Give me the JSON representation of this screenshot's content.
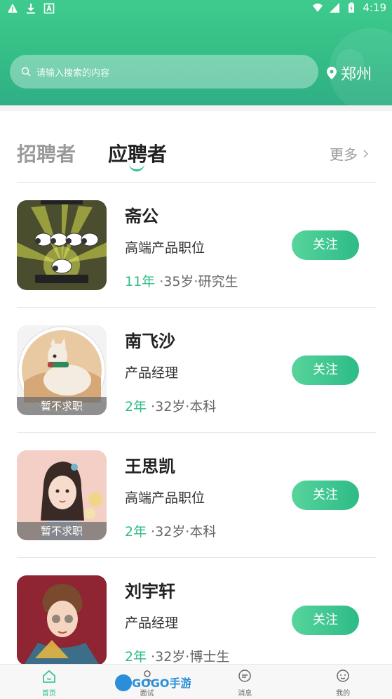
{
  "statusbar": {
    "time": "4:19"
  },
  "header": {
    "search_placeholder": "请输入搜索的内容",
    "location": "郑州"
  },
  "tabs": {
    "recruiter": "招聘者",
    "applicant": "应聘者",
    "more": "更多"
  },
  "candidates": [
    {
      "name": "斋公",
      "position": "高端产品职位",
      "years": "11年",
      "details": "·35岁·研究生",
      "follow": "关注",
      "badge": ""
    },
    {
      "name": "南飞沙",
      "position": "产品经理",
      "years": "2年",
      "details": "·32岁·本科",
      "follow": "关注",
      "badge": "暂不求职"
    },
    {
      "name": "王思凯",
      "position": "高端产品职位",
      "years": "2年",
      "details": "·32岁·本科",
      "follow": "关注",
      "badge": "暂不求职"
    },
    {
      "name": "刘宇轩",
      "position": "产品经理",
      "years": "2年",
      "details": "·32岁·博士生",
      "follow": "关注",
      "badge": ""
    }
  ],
  "nav": {
    "home": "首页",
    "interview": "面试",
    "message": "消息",
    "mine": "我的"
  },
  "colors": {
    "brand_green": "#2ebd85",
    "header_green": "#3fcb8e"
  }
}
